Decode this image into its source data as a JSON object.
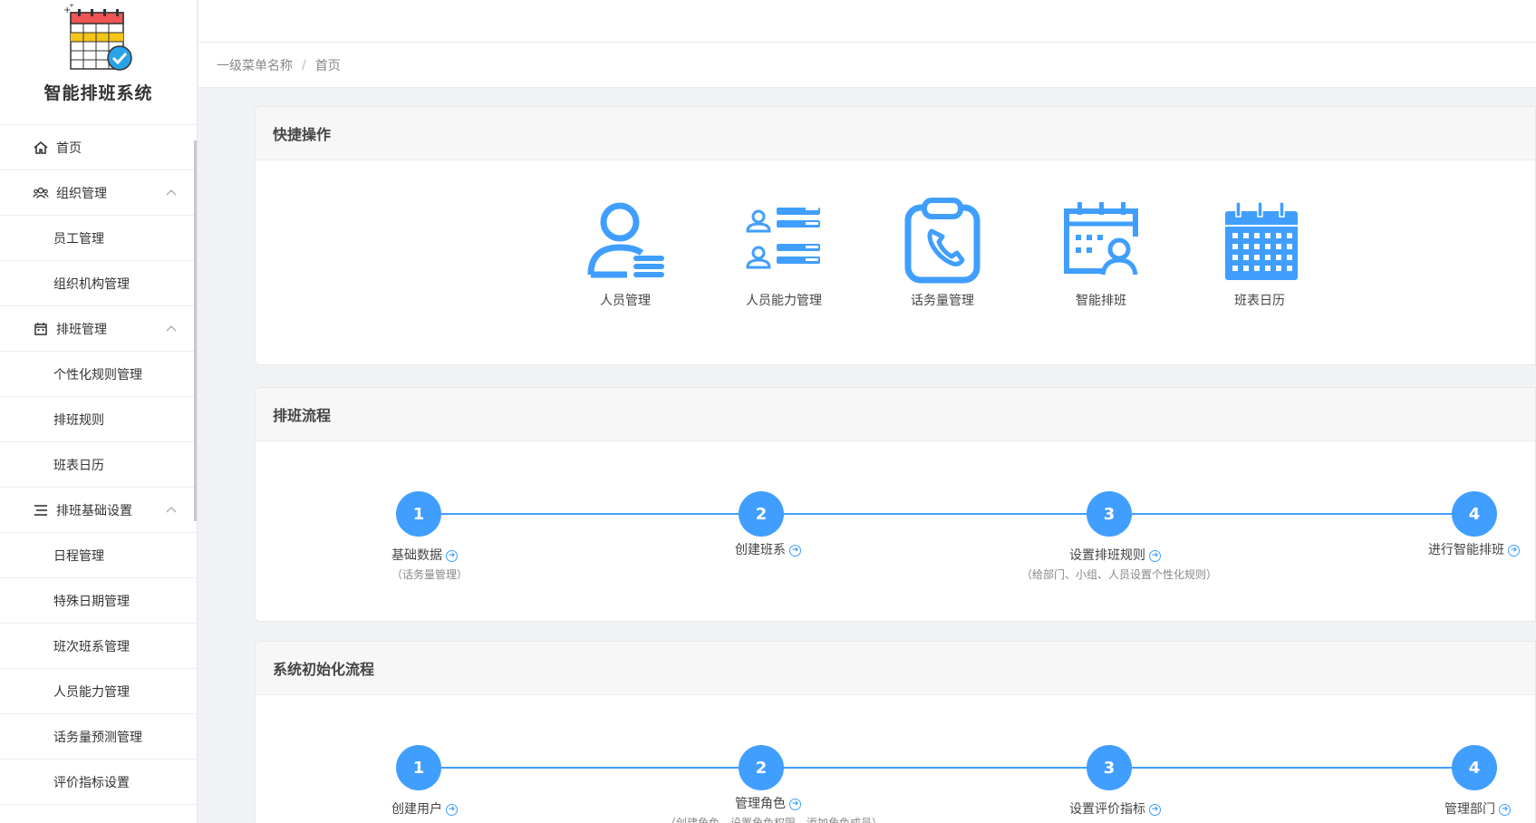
{
  "app": {
    "title": "智能排班系统"
  },
  "sidebar": {
    "items": [
      {
        "label": "首页",
        "icon": "home-icon",
        "level": "top"
      },
      {
        "label": "组织管理",
        "icon": "users-icon",
        "level": "top",
        "expanded": true
      },
      {
        "label": "员工管理",
        "level": "sub"
      },
      {
        "label": "组织机构管理",
        "level": "sub"
      },
      {
        "label": "排班管理",
        "icon": "calendar-icon",
        "level": "top",
        "expanded": true
      },
      {
        "label": "个性化规则管理",
        "level": "sub"
      },
      {
        "label": "排班规则",
        "level": "sub"
      },
      {
        "label": "班表日历",
        "level": "sub"
      },
      {
        "label": "排班基础设置",
        "icon": "list-icon",
        "level": "top",
        "expanded": true
      },
      {
        "label": "日程管理",
        "level": "sub"
      },
      {
        "label": "特殊日期管理",
        "level": "sub"
      },
      {
        "label": "班次班系管理",
        "level": "sub"
      },
      {
        "label": "人员能力管理",
        "level": "sub"
      },
      {
        "label": "话务量预测管理",
        "level": "sub"
      },
      {
        "label": "评价指标设置",
        "level": "sub"
      }
    ]
  },
  "breadcrumb": {
    "level1": "一级菜单名称",
    "separator": "/",
    "current": "首页"
  },
  "quick_actions": {
    "title": "快捷操作",
    "items": [
      {
        "label": "人员管理",
        "icon": "person-list-icon"
      },
      {
        "label": "人员能力管理",
        "icon": "people-skill-icon"
      },
      {
        "label": "话务量管理",
        "icon": "clipboard-phone-icon"
      },
      {
        "label": "智能排班",
        "icon": "calendar-person-icon"
      },
      {
        "label": "班表日历",
        "icon": "calendar-grid-icon"
      }
    ]
  },
  "schedule_flow": {
    "title": "排班流程",
    "steps": [
      {
        "num": "1",
        "label": "基础数据",
        "sub": "（话务量管理）"
      },
      {
        "num": "2",
        "label": "创建班系",
        "sub": ""
      },
      {
        "num": "3",
        "label": "设置排班规则",
        "sub": "（给部门、小组、人员设置个性化规则）"
      },
      {
        "num": "4",
        "label": "进行智能排班",
        "sub": ""
      }
    ]
  },
  "init_flow": {
    "title": "系统初始化流程",
    "steps": [
      {
        "num": "1",
        "label": "创建用户",
        "sub": ""
      },
      {
        "num": "2",
        "label": "管理角色",
        "sub": "（创建角色、设置角色权限、添加角色成员）"
      },
      {
        "num": "3",
        "label": "设置评价指标",
        "sub": ""
      },
      {
        "num": "4",
        "label": "管理部门",
        "sub": ""
      }
    ]
  },
  "colors": {
    "primary": "#409eff",
    "calendar_red": "#f05454",
    "calendar_yellow": "#f5c518"
  }
}
